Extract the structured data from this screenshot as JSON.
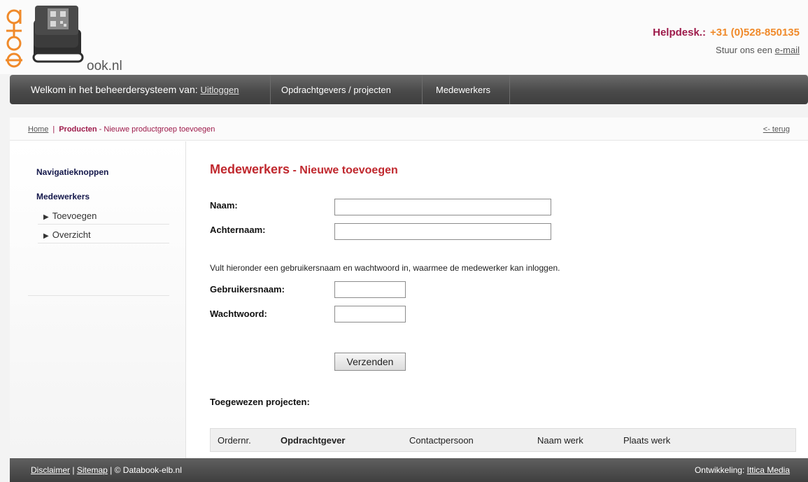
{
  "header": {
    "logo_text": "ook.nl",
    "logo_vertical": "data",
    "helpdesk_label": "Helpdesk.:",
    "helpdesk_phone": "+31 (0)528-850135",
    "mail_prefix": "Stuur ons een ",
    "mail_link": "e-mail"
  },
  "nav": {
    "welcome": "Welkom in het beheerdersysteem van: ",
    "logout": "Uitloggen",
    "items": [
      "Opdrachtgevers / projecten",
      "Medewerkers"
    ]
  },
  "breadcrumb": {
    "home": "Home",
    "sep": "|",
    "current": "Producten",
    "sub": " - Nieuwe productgroep toevoegen",
    "back": "<- terug"
  },
  "sidebar": {
    "title": "Navigatieknoppen",
    "section": "Medewerkers",
    "items": [
      "Toevoegen",
      "Overzicht"
    ]
  },
  "main": {
    "title": "Medewerkers",
    "title_sub": " - Nieuwe toevoegen",
    "naam_label": "Naam:",
    "naam_value": "",
    "achternaam_label": "Achternaam:",
    "achternaam_value": "",
    "hint": "Vult hieronder een gebruikersnaam en wachtwoord in, waarmee de medewerker kan inloggen.",
    "gebruikersnaam_label": "Gebruikersnaam:",
    "gebruikersnaam_value": "",
    "wachtwoord_label": "Wachtwoord:",
    "wachtwoord_value": "",
    "submit": "Verzenden",
    "assigned_title": "Toegewezen projecten:",
    "table_columns": [
      "Ordernr.",
      "Opdrachtgever",
      "Contactpersoon",
      "Naam werk",
      "Plaats werk"
    ]
  },
  "footer": {
    "disclaimer": "Disclaimer",
    "sitemap": "Sitemap",
    "copyright": " | © Databook-elb.nl",
    "dev_label": "Ontwikkeling: ",
    "dev_link": "Ittica Media"
  },
  "colors": {
    "accent_red": "#c0282e",
    "brand_purple": "#9d1a4a",
    "phone_orange": "#f08a2a",
    "nav_dark": "#4a4a4a"
  }
}
